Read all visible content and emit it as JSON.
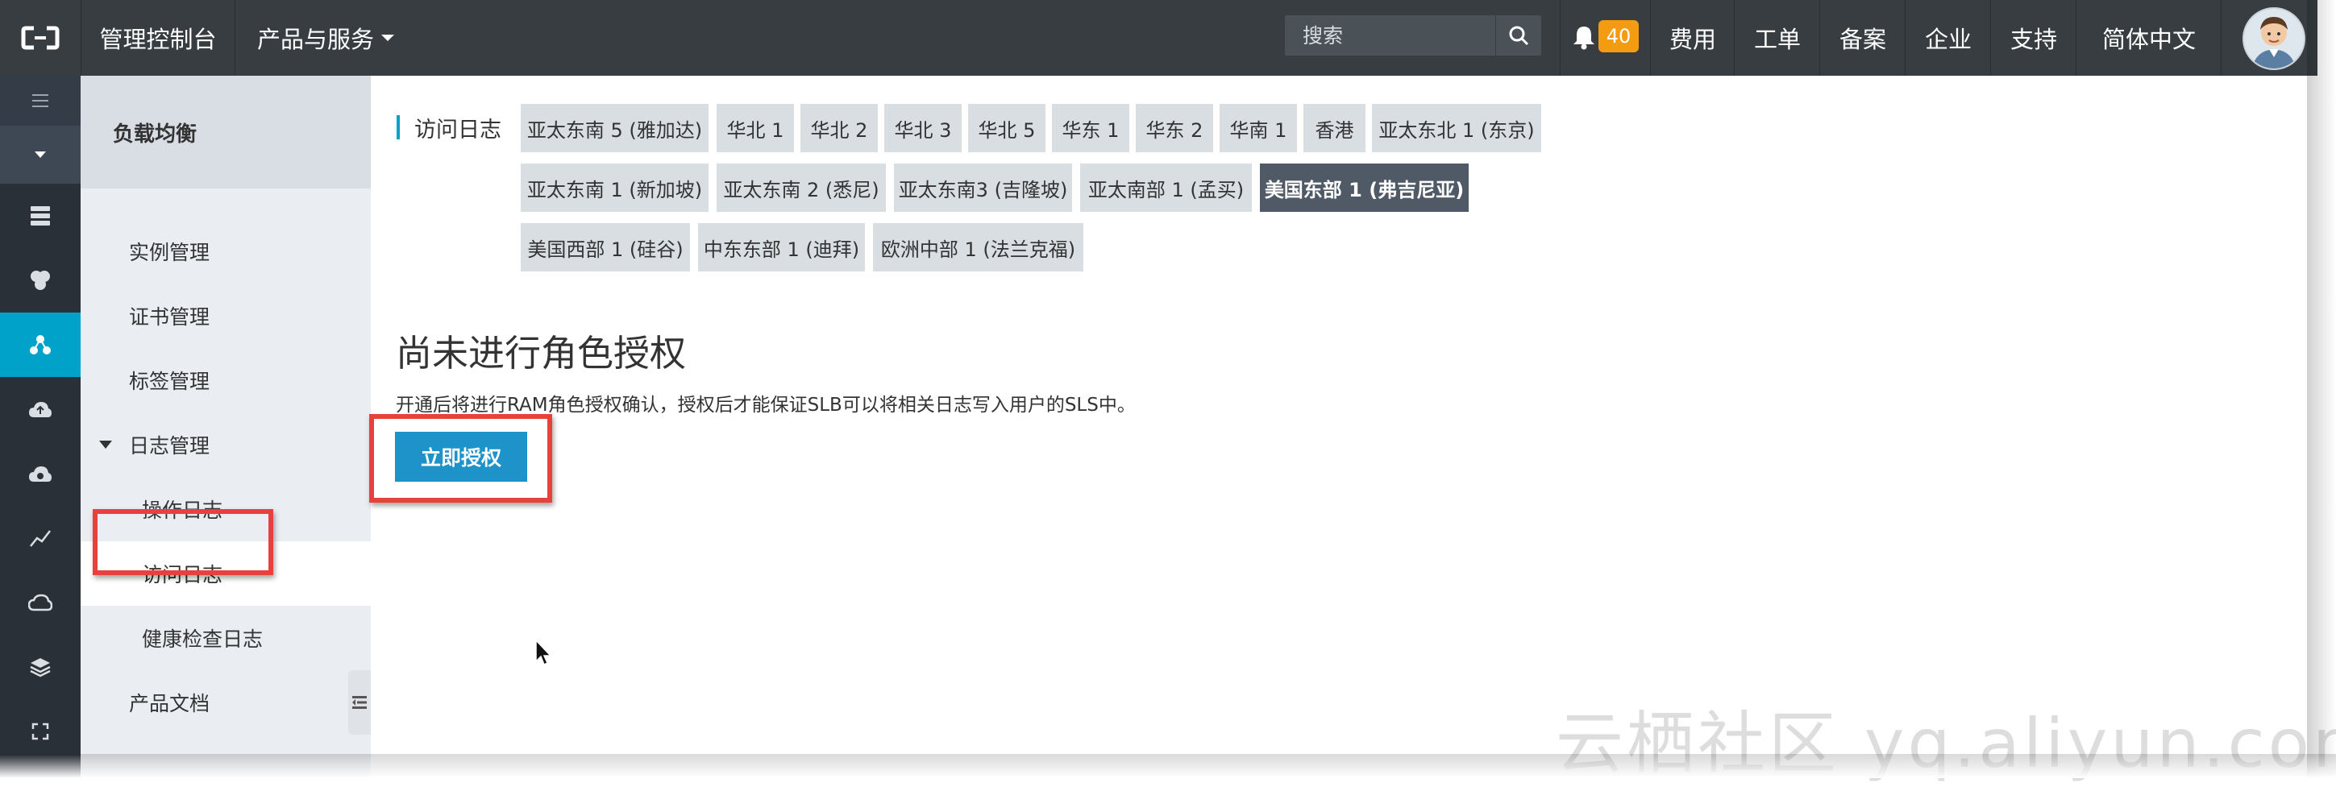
{
  "topbar": {
    "console": "管理控制台",
    "products": "产品与服务",
    "search_placeholder": "搜索",
    "notification_count": "40",
    "links": [
      "费用",
      "工单",
      "备案",
      "企业",
      "支持",
      "简体中文"
    ]
  },
  "rail": {
    "icons": [
      "menu-icon",
      "caret-down-icon",
      "server-list-icon",
      "cluster-icon",
      "load-balancer-icon",
      "cloud-upload-icon",
      "cloud-settings-icon",
      "trend-chart-icon",
      "cloud-icon",
      "layers-icon",
      "expand-icon"
    ]
  },
  "sidebar": {
    "header": "负载均衡",
    "items": [
      "实例管理",
      "证书管理",
      "标签管理",
      "日志管理",
      "操作日志",
      "访问日志",
      "健康检查日志",
      "产品文档"
    ]
  },
  "main": {
    "section_title": "访问日志",
    "regions": [
      "亚太东南 5 (雅加达)",
      "华北 1",
      "华北 2",
      "华北 3",
      "华北 5",
      "华东 1",
      "华东 2",
      "华南 1",
      "香港",
      "亚太东北 1 (东京)",
      "亚太东南 1 (新加坡)",
      "亚太东南 2 (悉尼)",
      "亚太东南3 (吉隆坡)",
      "亚太南部 1 (孟买)",
      "美国东部 1 (弗吉尼亚)",
      "美国西部 1 (硅谷)",
      "中东东部 1 (迪拜)",
      "欧洲中部 1 (法兰克福)"
    ],
    "selected_region": "美国东部 1 (弗吉尼亚)",
    "headline": "尚未进行角色授权",
    "description": "开通后将进行RAM角色授权确认，授权后才能保证SLB可以将相关日志写入用户的SLS中。",
    "authorize_button": "立即授权"
  },
  "watermark": "云栖社区 yq.aliyun.com",
  "colors": {
    "topbar": "#373d41",
    "rail": "#293038",
    "rail_active": "#00a2ca",
    "primary_button": "#1d93c9",
    "highlight": "#e8413d",
    "badge": "#f39c12"
  }
}
